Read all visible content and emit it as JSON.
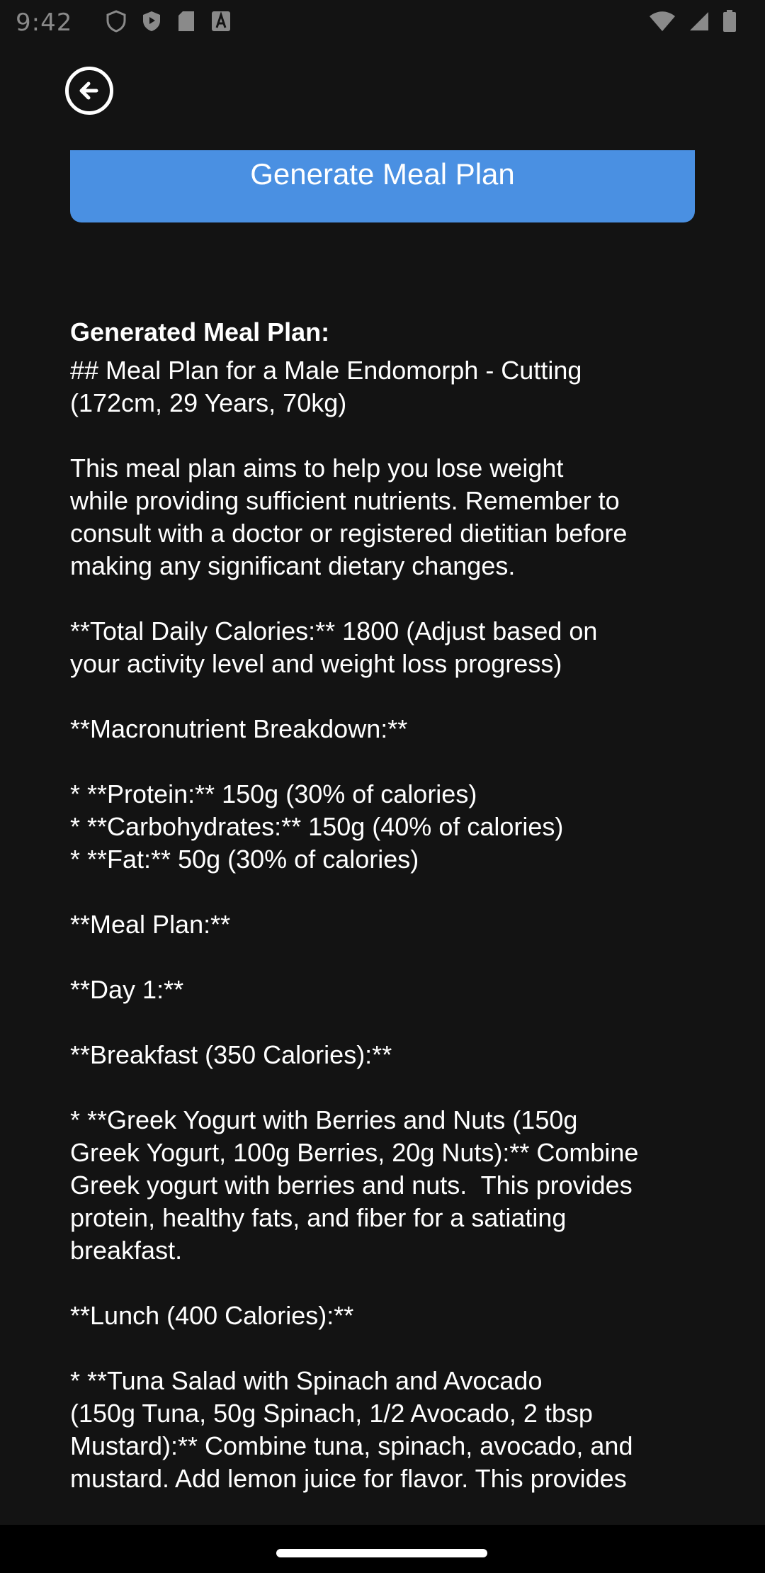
{
  "status_bar": {
    "time": "9:42"
  },
  "toolbar": {
    "back_icon": "arrow-left-circle-icon"
  },
  "generate_button": {
    "label": "Generate Meal Plan"
  },
  "result": {
    "label": "Generated Meal Plan:",
    "text": "## Meal Plan for a Male Endomorph - Cutting\n(172cm, 29 Years, 70kg)\n\nThis meal plan aims to help you lose weight\nwhile providing sufficient nutrients. Remember to\nconsult with a doctor or registered dietitian before\nmaking any significant dietary changes.\n\n**Total Daily Calories:** 1800 (Adjust based on\nyour activity level and weight loss progress)\n\n**Macronutrient Breakdown:**\n\n* **Protein:** 150g (30% of calories)\n* **Carbohydrates:** 150g (40% of calories)\n* **Fat:** 50g (30% of calories)\n\n**Meal Plan:**\n\n**Day 1:**\n\n**Breakfast (350 Calories):**\n\n* **Greek Yogurt with Berries and Nuts (150g\nGreek Yogurt, 100g Berries, 20g Nuts):** Combine\nGreek yogurt with berries and nuts.  This provides\nprotein, healthy fats, and fiber for a satiating\nbreakfast.\n\n**Lunch (400 Calories):**\n\n* **Tuna Salad with Spinach and Avocado\n(150g Tuna, 50g Spinach, 1/2 Avocado, 2 tbsp\nMustard):** Combine tuna, spinach, avocado, and\nmustard. Add lemon juice for flavor. This provides"
  },
  "colors": {
    "background": "#131313",
    "accent": "#4a90e2",
    "text": "#ffffff"
  }
}
